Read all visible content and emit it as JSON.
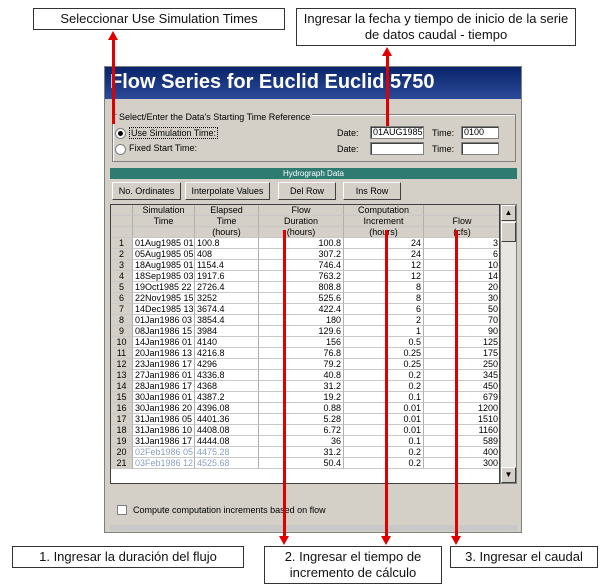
{
  "annotations": {
    "top_left": "Seleccionar Use Simulation Times",
    "top_right": "Ingresar la fecha y tiempo de inicio de la serie de datos caudal - tiempo",
    "bottom_1": "1. Ingresar la duración del flujo",
    "bottom_2": "2. Ingresar el tiempo de incremento de cálculo",
    "bottom_3": "3. Ingresar el caudal",
    "arrow_color": "#e00000"
  },
  "window": {
    "title": "Flow Series for Euclid Euclid 5750",
    "time_reference": {
      "group_label": "Select/Enter the Data's Starting Time Reference",
      "use_simulation_time_label": "Use Simulation Time:",
      "fixed_start_time_label": "Fixed Start Time:",
      "selected": "use_simulation_time",
      "date_label": "Date:",
      "time_label": "Time:",
      "sim_date": "01AUG1985",
      "sim_time": "0100",
      "fixed_date": "",
      "fixed_time": ""
    },
    "hydrograph_label": "Hydrograph Data",
    "buttons": {
      "no_ordinates": "No. Ordinates",
      "interpolate": "Interpolate Values",
      "del_row": "Del Row",
      "ins_row": "Ins Row"
    },
    "columns": [
      {
        "line1": "",
        "line2": "",
        "line3": ""
      },
      {
        "line1": "Simulation",
        "line2": "Time",
        "line3": ""
      },
      {
        "line1": "Elapsed",
        "line2": "Time",
        "line3": "(hours)"
      },
      {
        "line1": "Flow",
        "line2": "Duration",
        "line3": "(hours)"
      },
      {
        "line1": "Computation",
        "line2": "Increment",
        "line3": "(hours)"
      },
      {
        "line1": "",
        "line2": "Flow",
        "line3": "(cfs)"
      }
    ],
    "rows": [
      [
        "1",
        "01Aug1985 01",
        "100.8",
        "100.8",
        "24",
        "3"
      ],
      [
        "2",
        "05Aug1985 05",
        "408",
        "307.2",
        "24",
        "6"
      ],
      [
        "3",
        "18Aug1985 01",
        "1154.4",
        "746.4",
        "12",
        "10"
      ],
      [
        "4",
        "18Sep1985 03",
        "1917.6",
        "763.2",
        "12",
        "14"
      ],
      [
        "5",
        "19Oct1985 22",
        "2726.4",
        "808.8",
        "8",
        "20"
      ],
      [
        "6",
        "22Nov1985 15",
        "3252",
        "525.6",
        "8",
        "30"
      ],
      [
        "7",
        "14Dec1985 13",
        "3674.4",
        "422.4",
        "6",
        "50"
      ],
      [
        "8",
        "01Jan1986 03",
        "3854.4",
        "180",
        "2",
        "70"
      ],
      [
        "9",
        "08Jan1986 15",
        "3984",
        "129.6",
        "1",
        "90"
      ],
      [
        "10",
        "14Jan1986 01",
        "4140",
        "156",
        "0.5",
        "125"
      ],
      [
        "11",
        "20Jan1986 13",
        "4216.8",
        "76.8",
        "0.25",
        "175"
      ],
      [
        "12",
        "23Jan1986 17",
        "4296",
        "79.2",
        "0.25",
        "250"
      ],
      [
        "13",
        "27Jan1986 01",
        "4336.8",
        "40.8",
        "0.2",
        "345"
      ],
      [
        "14",
        "28Jan1986 17",
        "4368",
        "31.2",
        "0.2",
        "450"
      ],
      [
        "15",
        "30Jan1986 01",
        "4387.2",
        "19.2",
        "0.1",
        "679"
      ],
      [
        "16",
        "30Jan1986 20",
        "4396.08",
        "0.88",
        "0.01",
        "1200"
      ],
      [
        "17",
        "31Jan1986 05",
        "4401.36",
        "5.28",
        "0.01",
        "1510"
      ],
      [
        "18",
        "31Jan1986 10",
        "4408.08",
        "6.72",
        "0.01",
        "1160"
      ],
      [
        "19",
        "31Jan1986 17",
        "4444.08",
        "36",
        "0.1",
        "589"
      ],
      [
        "20",
        "02Feb1986 05",
        "4475.28",
        "31.2",
        "0.2",
        "400"
      ],
      [
        "21",
        "03Feb1986 12",
        "4525.68",
        "50.4",
        "0.2",
        "300"
      ]
    ],
    "checkbox_label": "Compute computation increments based on flow",
    "checkbox_checked": false
  }
}
